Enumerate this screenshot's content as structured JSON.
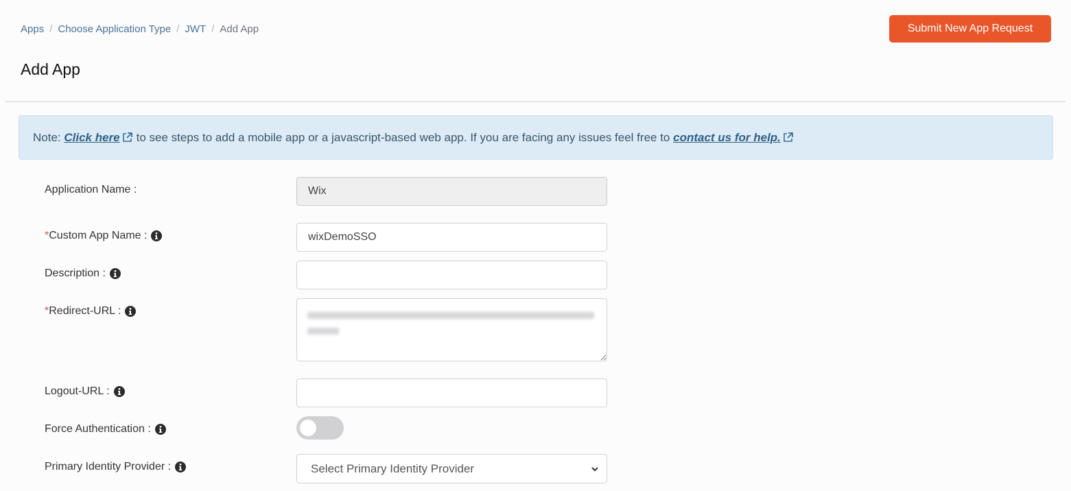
{
  "breadcrumb": [
    {
      "label": "Apps",
      "link": true
    },
    {
      "label": "Choose Application Type",
      "link": true
    },
    {
      "label": "JWT",
      "link": true
    },
    {
      "label": "Add App",
      "link": false
    }
  ],
  "header": {
    "title": "Add App",
    "submit_button": "Submit New App Request"
  },
  "colors": {
    "accent": "#e8562a",
    "note_background": "#dcebf6",
    "link": "#2f5f85",
    "required": "#d9534f"
  },
  "note": {
    "prefix": "Note:",
    "link1": "Click here",
    "middle": "to see steps to add a mobile app or a javascript-based web app. If you are facing any issues feel free to",
    "link2": "contact us for help.",
    "link_icon": "external-link-icon"
  },
  "form": {
    "application_name": {
      "label": "Application Name :",
      "value": "Wix"
    },
    "custom_app_name": {
      "required_mark": "*",
      "label": "Custom App Name :",
      "value": "wixDemoSSO",
      "icon": "info-icon"
    },
    "description": {
      "label": "Description :",
      "value": "",
      "icon": "info-icon"
    },
    "redirect_url": {
      "required_mark": "*",
      "label": "Redirect-URL :",
      "value": "[blurred URL]",
      "icon": "info-icon"
    },
    "logout_url": {
      "label": "Logout-URL :",
      "value": "",
      "icon": "info-icon"
    },
    "force_authentication": {
      "label": "Force Authentication :",
      "enabled": false,
      "icon": "info-icon"
    },
    "primary_idp": {
      "label": "Primary Identity Provider :",
      "selected": "Select Primary Identity Provider",
      "icon": "info-icon"
    }
  }
}
